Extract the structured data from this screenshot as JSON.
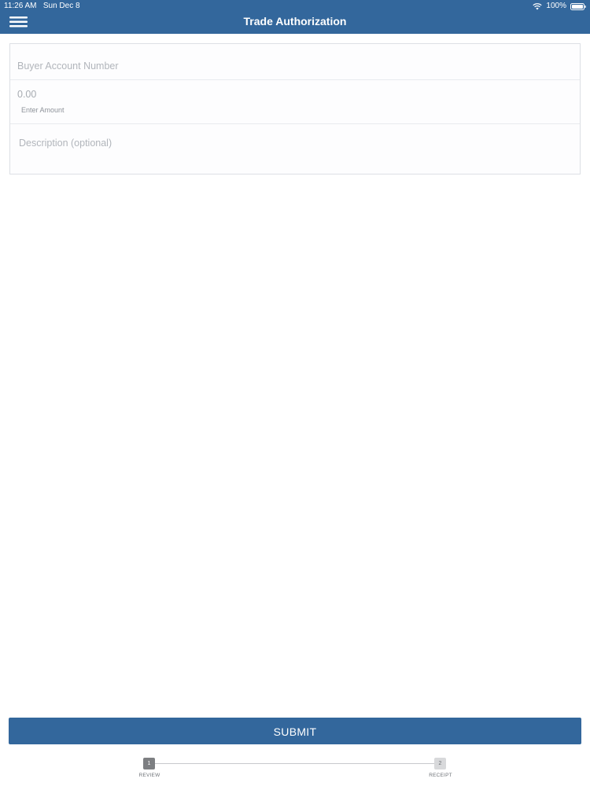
{
  "status_bar": {
    "time_date": "11:26 AM   Sun Dec 8",
    "battery": "100%"
  },
  "header": {
    "title": "Trade Authorization",
    "background_color": "#33679c"
  },
  "icons": {
    "menu": "hamburger-menu-icon",
    "wifi": "wifi-icon",
    "battery": "battery-icon"
  },
  "form": {
    "account": {
      "placeholder": "Buyer Account Number",
      "value": ""
    },
    "amount": {
      "value": "0.00",
      "caption": "Enter Amount"
    },
    "description": {
      "placeholder": "Description (optional)",
      "value": ""
    }
  },
  "submit": {
    "label": "SUBMIT"
  },
  "stepper": {
    "steps": [
      {
        "number": "1",
        "label": "REVIEW",
        "active": true
      },
      {
        "number": "2",
        "label": "RECEIPT",
        "active": false
      }
    ]
  }
}
